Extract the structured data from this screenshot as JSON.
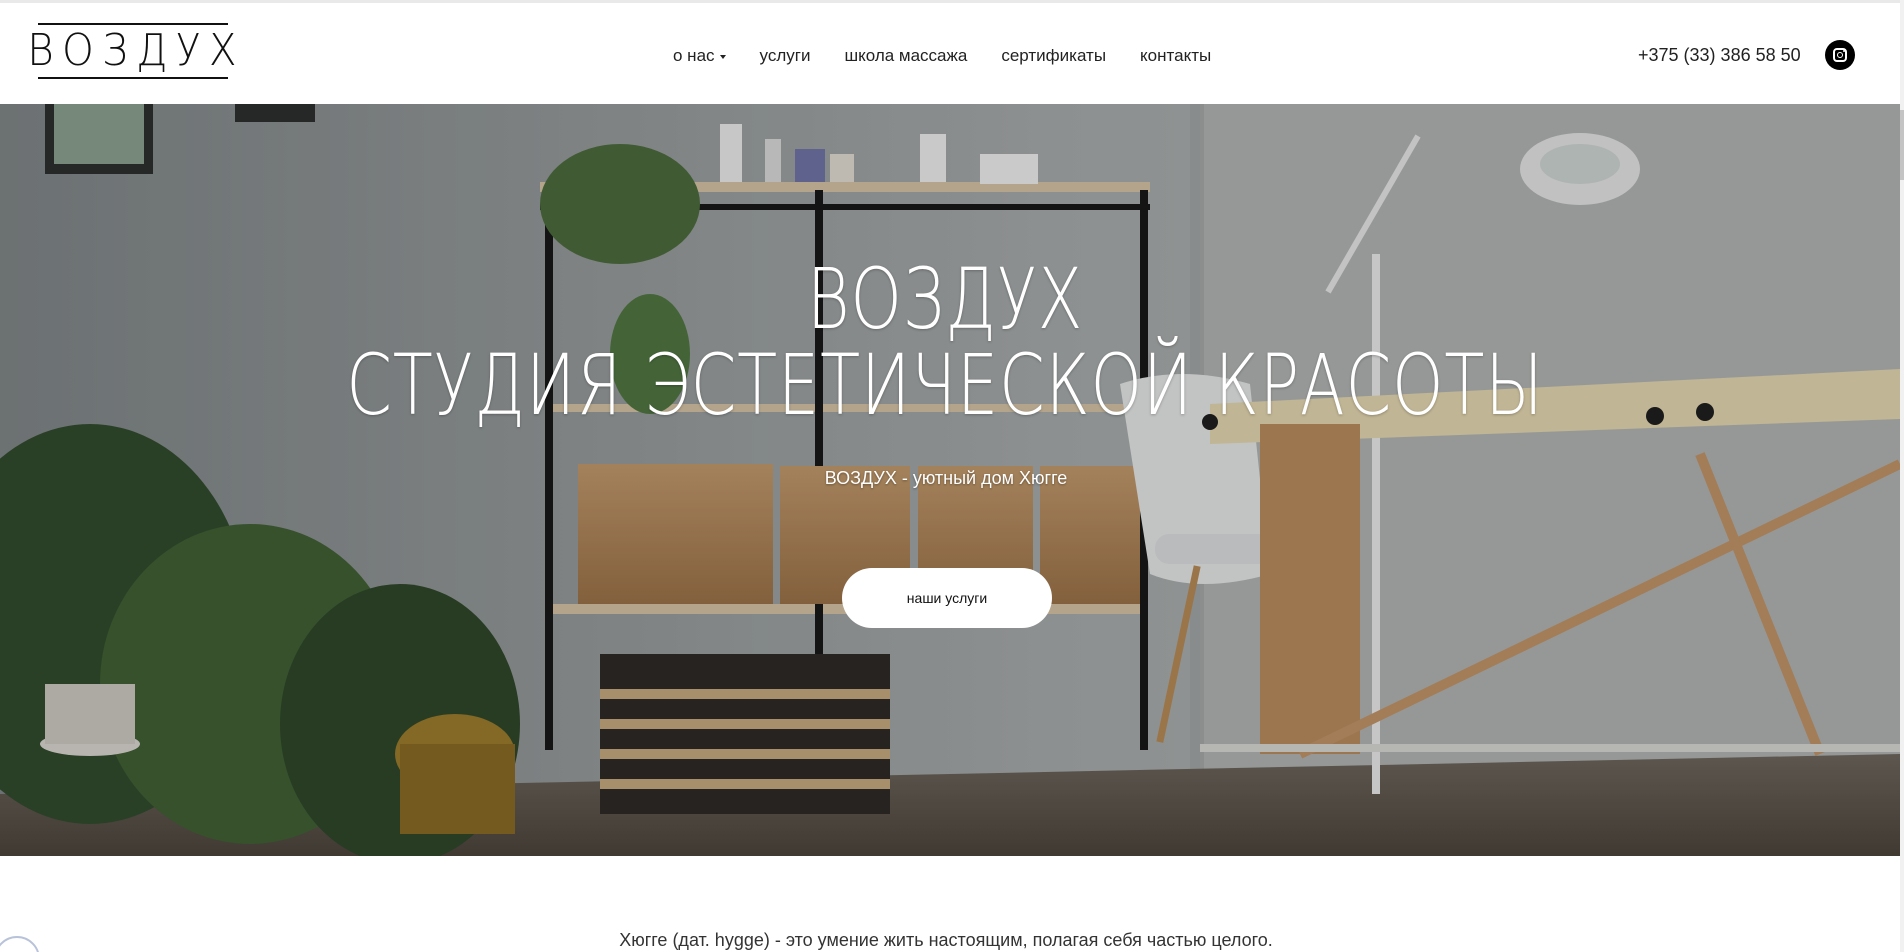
{
  "header": {
    "logo": "ВОЗДУХ",
    "nav": [
      {
        "label": "о нас",
        "has_dropdown": true
      },
      {
        "label": "услуги",
        "has_dropdown": false
      },
      {
        "label": "школа массажа",
        "has_dropdown": false
      },
      {
        "label": "сертификаты",
        "has_dropdown": false
      },
      {
        "label": "контакты",
        "has_dropdown": false
      }
    ],
    "phone": "+375 (33) 386 58 50",
    "social_icon": "instagram-icon"
  },
  "hero": {
    "title_line1": "ВОЗДУХ",
    "title_line2": "СТУДИЯ ЭСТЕТИЧЕСКОЙ КРАСОТЫ",
    "subtitle": "ВОЗДУХ - уютный дом Хюгге",
    "button_label": "наши услуги"
  },
  "intro": {
    "text": "Хюгге (дат. hygge) - это умение жить настоящим, полагая себя частью целого."
  },
  "colors": {
    "text": "#222222",
    "hero_text": "#ffffff",
    "button_bg": "#ffffff"
  }
}
